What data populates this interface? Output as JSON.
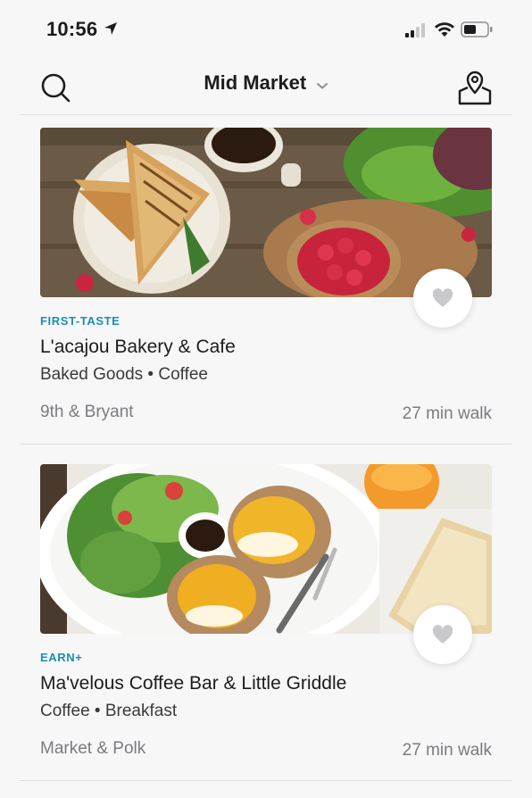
{
  "status_bar": {
    "time": "10:56"
  },
  "header": {
    "title": "Mid Market"
  },
  "listings": [
    {
      "badge": "FIRST-TASTE",
      "name": "L'acajou Bakery & Cafe",
      "categories": "Baked Goods • Coffee",
      "location": "9th & Bryant",
      "walk_time": "27 min walk",
      "image": "panini-coffee-raspberries-photo",
      "favorite_icon": "heart-icon"
    },
    {
      "badge": "EARN+",
      "name": "Ma'velous Coffee Bar & Little Griddle",
      "categories": "Coffee • Breakfast",
      "location": "Market & Polk",
      "walk_time": "27 min walk",
      "image": "eggs-benedict-salad-toast-photo",
      "favorite_icon": "heart-icon"
    }
  ],
  "colors": {
    "badge": "#1a8fb0",
    "background": "#f7f7f8",
    "divider": "#dedee2",
    "heart": "#c9c9cc"
  }
}
